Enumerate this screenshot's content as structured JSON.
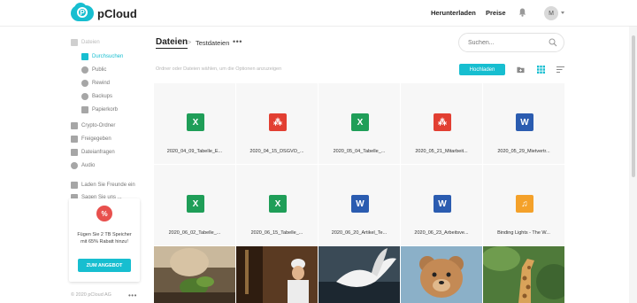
{
  "header": {
    "logo_text": "pCloud",
    "logo_glyph": "P",
    "download_label": "Herunterladen",
    "pricing_label": "Preise",
    "avatar_initial": "M"
  },
  "sidebar": {
    "files": "Dateien",
    "browse": "Durchsuchen",
    "public": "Public",
    "rewind": "Rewind",
    "backups": "Backups",
    "trash": "Papierkorb",
    "crypto": "Crypto-Ordner",
    "shared": "Freigegeben",
    "file_requests": "Dateianfragen",
    "audio": "Audio",
    "invite": "Laden Sie Freunde ein",
    "more_partial": "Sagen Sie uns ..."
  },
  "promo": {
    "badge": "%",
    "text": "Fügen Sie 2 TB Speicher mit 65% Rabatt hinzu!",
    "button": "ZUM ANGEBOT"
  },
  "footer": {
    "copyright": "© 2020 pCloud AG",
    "more": "•••"
  },
  "breadcrumb": {
    "root": "Dateien",
    "separator": ">",
    "current": "Testdateien",
    "more": "•••"
  },
  "search": {
    "placeholder": "Suchen..."
  },
  "toolbar": {
    "hint": "Ordner oder Dateien wählen, um die Optionen anzuzeigen",
    "upload_label": "Hochladen"
  },
  "files_row1": [
    {
      "icon": "excel-icon",
      "glyph": "X",
      "name": "2020_04_09_Tabelle_E..."
    },
    {
      "icon": "pdf-icon",
      "glyph": "⁂",
      "name": "2020_04_15_DSGVO_..."
    },
    {
      "icon": "excel-icon",
      "glyph": "X",
      "name": "2020_05_04_Tabelle_..."
    },
    {
      "icon": "pdf-icon",
      "glyph": "⁂",
      "name": "2020_05_21_Mitarbeit..."
    },
    {
      "icon": "word-icon",
      "glyph": "W",
      "name": "2020_05_29_Mietvertr..."
    }
  ],
  "files_row2": [
    {
      "icon": "excel-icon",
      "glyph": "X",
      "name": "2020_06_02_Tabelle_..."
    },
    {
      "icon": "excel-icon",
      "glyph": "X",
      "name": "2020_06_15_Tabelle_..."
    },
    {
      "icon": "word-icon",
      "glyph": "W",
      "name": "2020_06_20_Artikel_Te..."
    },
    {
      "icon": "word-icon",
      "glyph": "W",
      "name": "2020_06_23_Arbeitsve..."
    },
    {
      "icon": "music-icon",
      "glyph": "♫",
      "name": "Binding Lights - The W..."
    }
  ],
  "colors": {
    "accent": "#17bed0",
    "excel": "#1f9e58",
    "pdf": "#e23f32",
    "word": "#2b5cb0",
    "audio": "#f4a12a",
    "promo_badge": "#e8504d"
  }
}
